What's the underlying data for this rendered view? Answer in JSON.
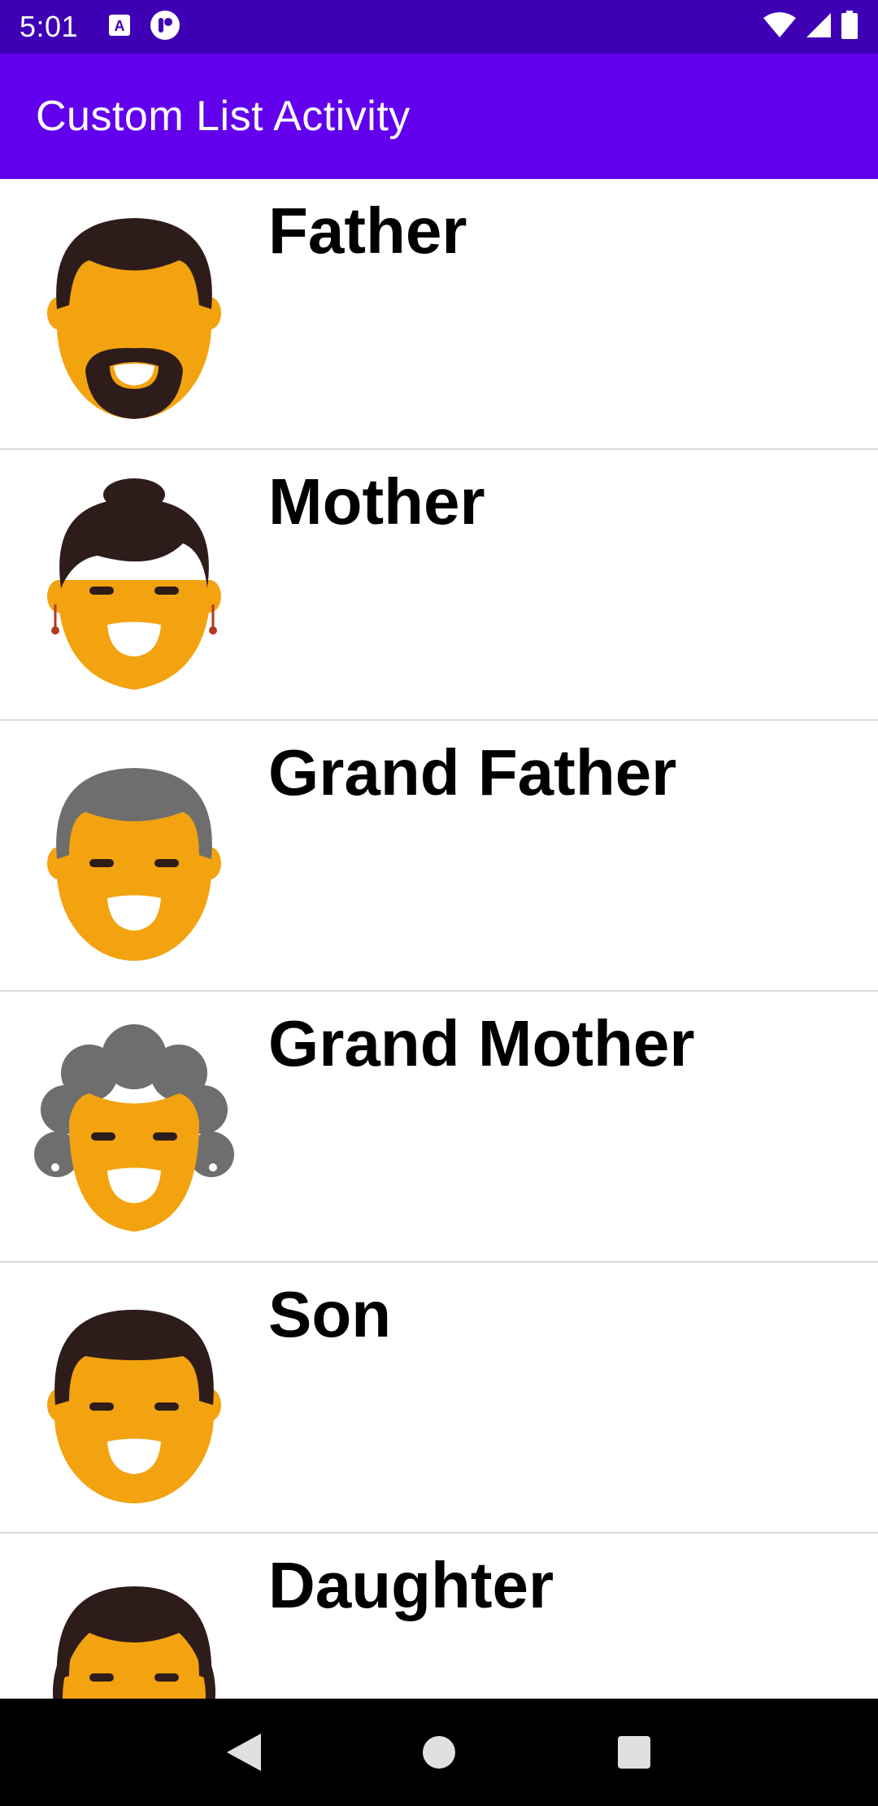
{
  "status_bar": {
    "time": "5:01",
    "left_icons": [
      "a-notification-icon",
      "podcast-notification-icon"
    ],
    "right_icons": [
      "wifi-icon",
      "cell-signal-icon",
      "battery-icon"
    ]
  },
  "app_bar": {
    "title": "Custom List Activity"
  },
  "list": {
    "items": [
      {
        "label": "Father",
        "avatar": "father-avatar-icon"
      },
      {
        "label": "Mother",
        "avatar": "mother-avatar-icon"
      },
      {
        "label": "Grand Father",
        "avatar": "grandfather-avatar-icon"
      },
      {
        "label": "Grand Mother",
        "avatar": "grandmother-avatar-icon"
      },
      {
        "label": "Son",
        "avatar": "son-avatar-icon"
      },
      {
        "label": "Daughter",
        "avatar": "daughter-avatar-icon"
      }
    ]
  },
  "nav_bar": {
    "buttons": [
      "back-icon",
      "home-icon",
      "recents-icon"
    ]
  },
  "colors": {
    "status_bar": "#3f00b5",
    "app_bar": "#6200ee",
    "skin": "#f2a30f",
    "hair_dark": "#2e1c1b",
    "hair_gray": "#6e6e6e"
  }
}
